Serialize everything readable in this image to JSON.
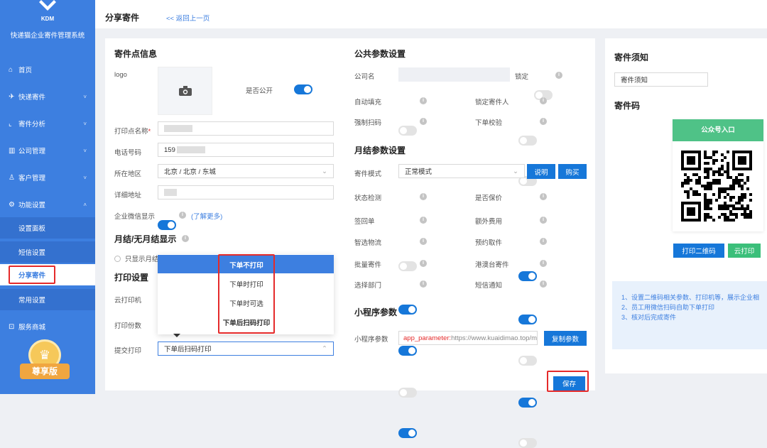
{
  "app": {
    "brand": "快递猫企业寄件管理系统",
    "logo_text": "KDM"
  },
  "sidebar": {
    "items": [
      {
        "label": "首页",
        "icon": "home-icon"
      },
      {
        "label": "快递寄件",
        "icon": "send-icon"
      },
      {
        "label": "寄件分析",
        "icon": "chart-icon"
      },
      {
        "label": "公司管理",
        "icon": "building-icon"
      },
      {
        "label": "客户管理",
        "icon": "user-icon"
      },
      {
        "label": "功能设置",
        "icon": "settings-icon"
      }
    ],
    "subitems": [
      "设置面板",
      "短信设置",
      "分享寄件",
      "常用设置"
    ],
    "shop": "服务商城",
    "badge": "尊享版"
  },
  "header": {
    "title": "分享寄件",
    "back": "<< 返回上一页"
  },
  "pickup": {
    "title": "寄件点信息",
    "logo_label": "logo",
    "public_label": "是否公开",
    "print_name_label": "打印点名称",
    "phone_label": "电话号码",
    "phone_value": "159",
    "region_label": "所在地区",
    "region_value": "北京 / 北京 / 东城",
    "address_label": "详细地址",
    "wechat_label": "企业微信显示",
    "wechat_more": "(了解更多)",
    "monthly_title": "月结/无月结显示",
    "radio_label": "只显示月结",
    "print_title": "打印设置",
    "cloud_printer_label": "云打印机",
    "copies_label": "打印份数",
    "submit_label": "提交打印",
    "submit_value": "下单后扫码打印"
  },
  "dropdown": {
    "options": [
      "下单不打印",
      "下单时打印",
      "下单时可选",
      "下单后扫码打印"
    ]
  },
  "public_params": {
    "title": "公共参数设置",
    "company_label": "公司名",
    "lock_label": "锁定",
    "auto_fill": "自动填充",
    "lock_sender": "锁定寄件人",
    "force_scan": "强制扫码",
    "order_check": "下单校验"
  },
  "monthly": {
    "title": "月结参数设置",
    "mode_label": "寄件模式",
    "mode_value": "正常模式",
    "explain_btn": "说明",
    "buy_btn": "购买",
    "toggles": [
      {
        "label": "状态检测",
        "on": false
      },
      {
        "label": "是否保价",
        "on": true
      },
      {
        "label": "签回单",
        "on": true
      },
      {
        "label": "额外费用",
        "on": true
      },
      {
        "label": "智选物流",
        "on": true
      },
      {
        "label": "预约取件",
        "on": false
      },
      {
        "label": "批量寄件",
        "on": false
      },
      {
        "label": "港澳台寄件",
        "on": true
      },
      {
        "label": "选择部门",
        "on": true
      },
      {
        "label": "短信通知",
        "on": false
      }
    ]
  },
  "mini": {
    "title": "小程序参数",
    "label": "小程序参数",
    "value_key": "app_parameter:",
    "value_url": "https://www.kuaidimao.top/m",
    "copy_btn": "复制参数"
  },
  "save_btn": "保存",
  "notice": {
    "title": "寄件须知",
    "input_value": "寄件须知",
    "code_title": "寄件码",
    "qr_header": "公众号入口",
    "print_qr_btn": "打印二维码",
    "cloud_print_btn": "云打印",
    "tips": [
      "1、设置二维码相关参数、打印机等，展示企业相",
      "2、员工用微信扫码自助下单打印",
      "3、核对后完成寄件"
    ]
  }
}
